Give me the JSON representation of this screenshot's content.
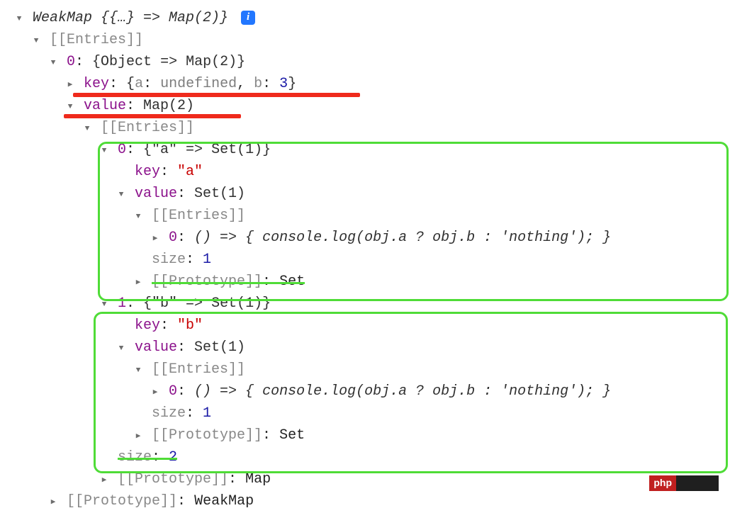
{
  "summary": "WeakMap {{…} => Map(2)}",
  "entries_label": "[[Entries]]",
  "entry0_summary": "{Object => Map(2)}",
  "key_label": "key",
  "value_label": "value",
  "key_obj": {
    "a_key": "a",
    "a_val": "undefined",
    "b_key": "b",
    "b_val": "3"
  },
  "map_value": "Map(2)",
  "map_entry_a": {
    "summary": "{\"a\" => Set(1)}",
    "key": "\"a\"",
    "value": "Set(1)"
  },
  "map_entry_b": {
    "summary": "{\"b\" => Set(1)}",
    "key": "\"b\"",
    "value": "Set(1)"
  },
  "set_entry": "() => { console.log(obj.a ? obj.b : 'nothing'); }",
  "size_label": "size",
  "size_1": "1",
  "size_2": "2",
  "proto_label": "[[Prototype]]",
  "proto_set": "Set",
  "proto_map": "Map",
  "proto_weakmap": "WeakMap",
  "zero": "0",
  "one": "1",
  "brand": "php"
}
